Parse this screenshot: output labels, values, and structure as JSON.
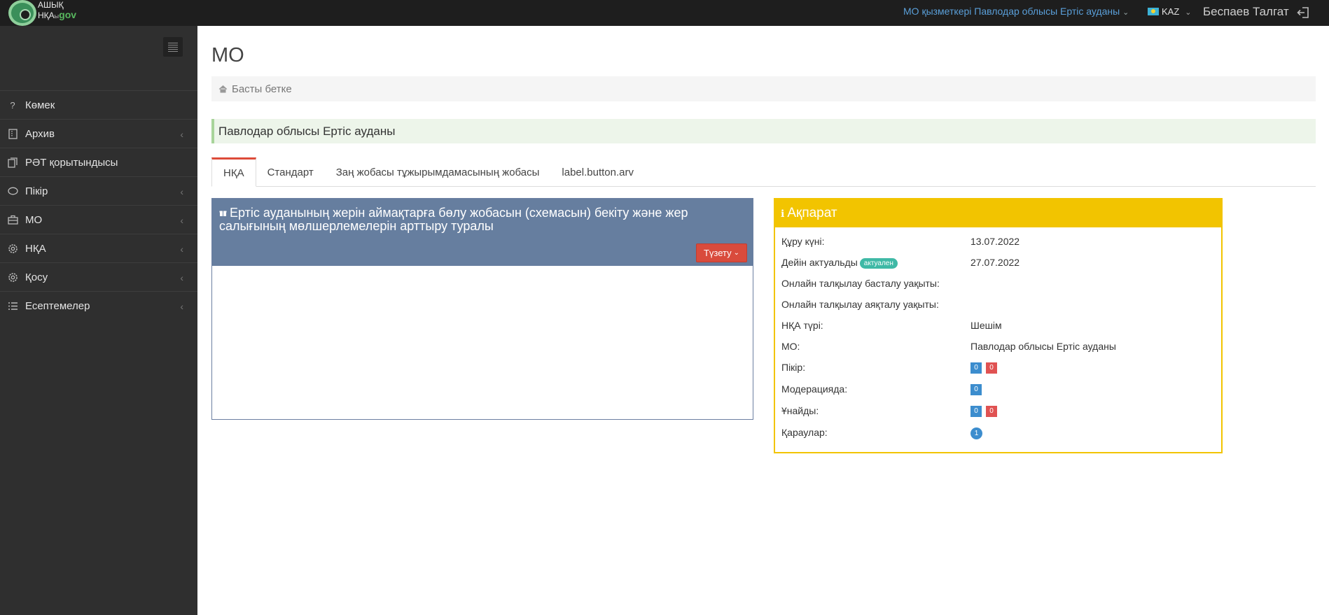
{
  "topbar": {
    "logo_line1": "АШЫҚ",
    "logo_line2_a": "НҚА",
    "logo_line2_b": "ы",
    "logo_line2_gov": "gov",
    "role": "МО қызметкері Павлодар облысы Ертіс ауданы",
    "lang": "KAZ",
    "user": "Беспаев Талгат"
  },
  "sidebar": {
    "items": [
      {
        "label": "Көмек",
        "icon": "question-icon",
        "has_submenu": false
      },
      {
        "label": "Архив",
        "icon": "archive-icon",
        "has_submenu": true
      },
      {
        "label": "РӘТ қорытындысы",
        "icon": "document-icon",
        "has_submenu": false
      },
      {
        "label": "Пікір",
        "icon": "comment-icon",
        "has_submenu": true
      },
      {
        "label": "МО",
        "icon": "briefcase-icon",
        "has_submenu": true
      },
      {
        "label": "НҚА",
        "icon": "gear-icon",
        "has_submenu": true
      },
      {
        "label": "Қосу",
        "icon": "gear-icon",
        "has_submenu": true
      },
      {
        "label": "Есептемелер",
        "icon": "list-icon",
        "has_submenu": true
      }
    ]
  },
  "main": {
    "title": "МО",
    "breadcrumb": "Басты бетке",
    "alert": "Павлодар облысы Ертіс ауданы",
    "tabs": [
      {
        "label": "НҚА",
        "active": true
      },
      {
        "label": "Стандарт",
        "active": false
      },
      {
        "label": "Заң жобасы тұжырымдамасының жобасы",
        "active": false
      },
      {
        "label": "label.button.arv",
        "active": false
      }
    ],
    "doc_panel": {
      "title": "Ертіс ауданының жерін аймақтарға бөлу жобасын (схемасын) бекіту және жер салығының мөлшерлемелерін арттыру туралы",
      "edit_button": "Түзету"
    },
    "info_panel": {
      "title": "Ақпарат",
      "rows": [
        {
          "label": "Құру күні:",
          "value": "13.07.2022"
        },
        {
          "label": "Дейін актуальды",
          "badge": "актуален",
          "value": "27.07.2022"
        },
        {
          "label": "Онлайн талқылау басталу уақыты:",
          "value": ""
        },
        {
          "label": "Онлайн талқылау аяқталу уақыты:",
          "value": ""
        },
        {
          "label": "НҚА түрі:",
          "value": "Шешім"
        },
        {
          "label": "МО:",
          "value": "Павлодар облысы Ертіс ауданы"
        },
        {
          "label": "Пікір:",
          "counts": [
            "0",
            "0"
          ]
        },
        {
          "label": "Модерацияда:",
          "counts": [
            "0"
          ]
        },
        {
          "label": "Ұнайды:",
          "counts": [
            "0",
            "0"
          ]
        },
        {
          "label": "Қараулар:",
          "circle": "1"
        }
      ]
    }
  },
  "colors": {
    "topbar": "#1e1e1e",
    "sidebar": "#2f2f2f",
    "doc_header": "#667e9f",
    "info_header": "#f2c400",
    "edit_button": "#d94b3c",
    "tab_active_border": "#dd4b39",
    "badge_blue": "#3c8dce",
    "badge_red": "#e05252",
    "badge_teal": "#3fb9a6"
  }
}
